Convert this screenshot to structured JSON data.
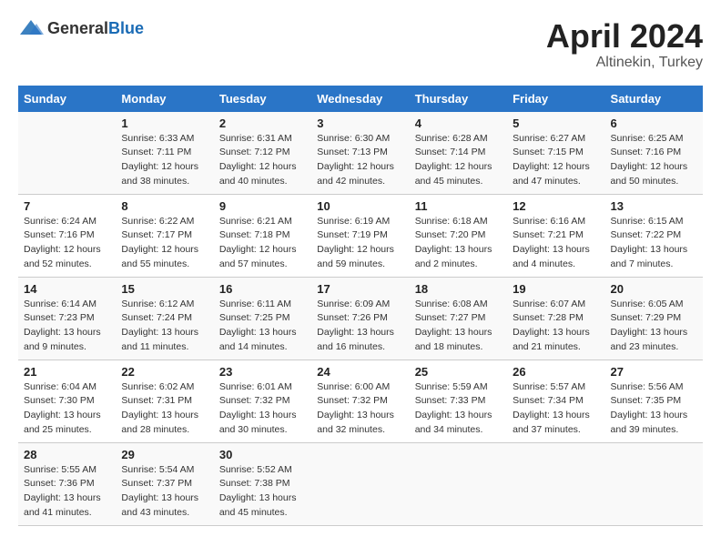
{
  "header": {
    "logo_general": "General",
    "logo_blue": "Blue",
    "title": "April 2024",
    "subtitle": "Altinekin, Turkey"
  },
  "calendar": {
    "days_of_week": [
      "Sunday",
      "Monday",
      "Tuesday",
      "Wednesday",
      "Thursday",
      "Friday",
      "Saturday"
    ],
    "weeks": [
      [
        {
          "day": "",
          "info": ""
        },
        {
          "day": "1",
          "info": "Sunrise: 6:33 AM\nSunset: 7:11 PM\nDaylight: 12 hours\nand 38 minutes."
        },
        {
          "day": "2",
          "info": "Sunrise: 6:31 AM\nSunset: 7:12 PM\nDaylight: 12 hours\nand 40 minutes."
        },
        {
          "day": "3",
          "info": "Sunrise: 6:30 AM\nSunset: 7:13 PM\nDaylight: 12 hours\nand 42 minutes."
        },
        {
          "day": "4",
          "info": "Sunrise: 6:28 AM\nSunset: 7:14 PM\nDaylight: 12 hours\nand 45 minutes."
        },
        {
          "day": "5",
          "info": "Sunrise: 6:27 AM\nSunset: 7:15 PM\nDaylight: 12 hours\nand 47 minutes."
        },
        {
          "day": "6",
          "info": "Sunrise: 6:25 AM\nSunset: 7:16 PM\nDaylight: 12 hours\nand 50 minutes."
        }
      ],
      [
        {
          "day": "7",
          "info": "Sunrise: 6:24 AM\nSunset: 7:16 PM\nDaylight: 12 hours\nand 52 minutes."
        },
        {
          "day": "8",
          "info": "Sunrise: 6:22 AM\nSunset: 7:17 PM\nDaylight: 12 hours\nand 55 minutes."
        },
        {
          "day": "9",
          "info": "Sunrise: 6:21 AM\nSunset: 7:18 PM\nDaylight: 12 hours\nand 57 minutes."
        },
        {
          "day": "10",
          "info": "Sunrise: 6:19 AM\nSunset: 7:19 PM\nDaylight: 12 hours\nand 59 minutes."
        },
        {
          "day": "11",
          "info": "Sunrise: 6:18 AM\nSunset: 7:20 PM\nDaylight: 13 hours\nand 2 minutes."
        },
        {
          "day": "12",
          "info": "Sunrise: 6:16 AM\nSunset: 7:21 PM\nDaylight: 13 hours\nand 4 minutes."
        },
        {
          "day": "13",
          "info": "Sunrise: 6:15 AM\nSunset: 7:22 PM\nDaylight: 13 hours\nand 7 minutes."
        }
      ],
      [
        {
          "day": "14",
          "info": "Sunrise: 6:14 AM\nSunset: 7:23 PM\nDaylight: 13 hours\nand 9 minutes."
        },
        {
          "day": "15",
          "info": "Sunrise: 6:12 AM\nSunset: 7:24 PM\nDaylight: 13 hours\nand 11 minutes."
        },
        {
          "day": "16",
          "info": "Sunrise: 6:11 AM\nSunset: 7:25 PM\nDaylight: 13 hours\nand 14 minutes."
        },
        {
          "day": "17",
          "info": "Sunrise: 6:09 AM\nSunset: 7:26 PM\nDaylight: 13 hours\nand 16 minutes."
        },
        {
          "day": "18",
          "info": "Sunrise: 6:08 AM\nSunset: 7:27 PM\nDaylight: 13 hours\nand 18 minutes."
        },
        {
          "day": "19",
          "info": "Sunrise: 6:07 AM\nSunset: 7:28 PM\nDaylight: 13 hours\nand 21 minutes."
        },
        {
          "day": "20",
          "info": "Sunrise: 6:05 AM\nSunset: 7:29 PM\nDaylight: 13 hours\nand 23 minutes."
        }
      ],
      [
        {
          "day": "21",
          "info": "Sunrise: 6:04 AM\nSunset: 7:30 PM\nDaylight: 13 hours\nand 25 minutes."
        },
        {
          "day": "22",
          "info": "Sunrise: 6:02 AM\nSunset: 7:31 PM\nDaylight: 13 hours\nand 28 minutes."
        },
        {
          "day": "23",
          "info": "Sunrise: 6:01 AM\nSunset: 7:32 PM\nDaylight: 13 hours\nand 30 minutes."
        },
        {
          "day": "24",
          "info": "Sunrise: 6:00 AM\nSunset: 7:32 PM\nDaylight: 13 hours\nand 32 minutes."
        },
        {
          "day": "25",
          "info": "Sunrise: 5:59 AM\nSunset: 7:33 PM\nDaylight: 13 hours\nand 34 minutes."
        },
        {
          "day": "26",
          "info": "Sunrise: 5:57 AM\nSunset: 7:34 PM\nDaylight: 13 hours\nand 37 minutes."
        },
        {
          "day": "27",
          "info": "Sunrise: 5:56 AM\nSunset: 7:35 PM\nDaylight: 13 hours\nand 39 minutes."
        }
      ],
      [
        {
          "day": "28",
          "info": "Sunrise: 5:55 AM\nSunset: 7:36 PM\nDaylight: 13 hours\nand 41 minutes."
        },
        {
          "day": "29",
          "info": "Sunrise: 5:54 AM\nSunset: 7:37 PM\nDaylight: 13 hours\nand 43 minutes."
        },
        {
          "day": "30",
          "info": "Sunrise: 5:52 AM\nSunset: 7:38 PM\nDaylight: 13 hours\nand 45 minutes."
        },
        {
          "day": "",
          "info": ""
        },
        {
          "day": "",
          "info": ""
        },
        {
          "day": "",
          "info": ""
        },
        {
          "day": "",
          "info": ""
        }
      ]
    ]
  }
}
